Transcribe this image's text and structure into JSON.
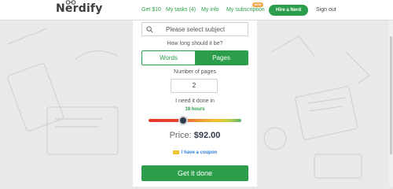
{
  "header": {
    "logo": "Nerdify",
    "nav": {
      "get_10": "Get $10",
      "my_tasks": "My tasks (4)",
      "my_info": "My info",
      "my_subscription": "My subscription",
      "subscription_badge": "NEW"
    },
    "hire_button": "Hire a Nerd",
    "sign_out": "Sign out"
  },
  "form": {
    "subject_placeholder": "Please select subject",
    "how_long": "How long should it be?",
    "length_options": [
      "Words",
      "Pages"
    ],
    "length_selected": "Pages",
    "num_pages_label": "Number of pages",
    "num_pages_value": "2",
    "need_done_label": "I need it done in",
    "deadline_value": "18 hours",
    "deadline_slider_position": 0.37,
    "price_label": "Price:",
    "price_value": "$92.00",
    "coupon_link": "I have a coupon",
    "submit_button": "Get it done"
  },
  "colors": {
    "brand_green": "#2c9e4b",
    "link_blue": "#2a7de1",
    "badge_orange": "#f5a142",
    "slider_thumb": "#2f3b4a"
  }
}
